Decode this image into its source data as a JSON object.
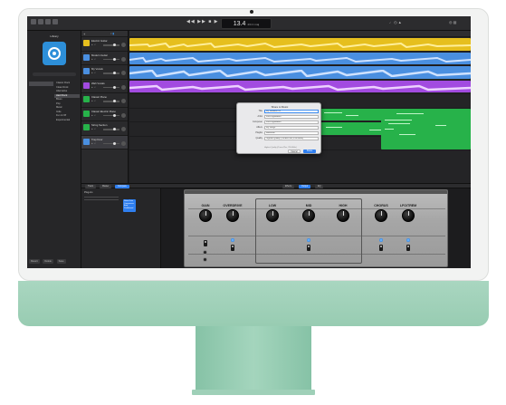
{
  "toolbar": {
    "lcd_main": "13.4",
    "lcd_sub": "4/4  C maj"
  },
  "library": {
    "title": "Library",
    "categories": [
      "",
      "",
      ""
    ],
    "subcategories": [
      "Classic Rock",
      "Clean Rock",
      "Alternative",
      "Hard Rock",
      "Blues",
      "Pop",
      "Metal",
      "Indie",
      "Fun & Off",
      "Experimental"
    ],
    "footer": [
      "Revert",
      "Delete",
      "Save"
    ]
  },
  "tracks": [
    {
      "name": "Electric Guitar",
      "color": "#e6bf1e"
    },
    {
      "name": "Modern Guitar",
      "color": "#4a8fe0"
    },
    {
      "name": "My Vocals",
      "color": "#4a8fe0"
    },
    {
      "name": "Wah Vocals",
      "color": "#a24be0"
    },
    {
      "name": "Classic Piano",
      "color": "#27b24a"
    },
    {
      "name": "Classic Electric Piano",
      "color": "#27b24a"
    },
    {
      "name": "String Section",
      "color": "#27b24a"
    },
    {
      "name": "Trap Door",
      "color": "#4a8fe0"
    }
  ],
  "dialog": {
    "title": "Share to Music",
    "fields": [
      {
        "label": "Title",
        "value": "My Greatest Hit"
      },
      {
        "label": "Artist",
        "value": "John Appleseed"
      },
      {
        "label": "Composer",
        "value": "John Appleseed"
      },
      {
        "label": "Album",
        "value": "My Songs"
      },
      {
        "label": "Playlist",
        "value": "Welcome"
      },
      {
        "label": "Quality",
        "value": "Highest Quality (iTunes Plus, 256 kBit/s)"
      }
    ],
    "note": "Highest Quality (iTunes Plus, 256 kBit/s)",
    "cancel": "Cancel",
    "share": "Share"
  },
  "smart_controls": {
    "tabs": [
      "Track",
      "Master",
      "Compare"
    ],
    "view_tabs": [
      "Effects",
      "Output",
      "EQ"
    ],
    "plugins_title": "Plug-ins",
    "blue_panel": [
      "Noise Gate",
      "Compressor",
      "Amp",
      "Pedalboard"
    ]
  },
  "amp": {
    "knobs": [
      "GAIN",
      "OVERDRIVE",
      "LOW",
      "MID",
      "HIGH",
      "CHORUS",
      "LFO/TREM"
    ]
  },
  "colors": {
    "yellow": "#e6bf1e",
    "blue": "#4a8fe0",
    "purple": "#a24be0",
    "green": "#27b24a",
    "accent": "#2f7ff0"
  }
}
